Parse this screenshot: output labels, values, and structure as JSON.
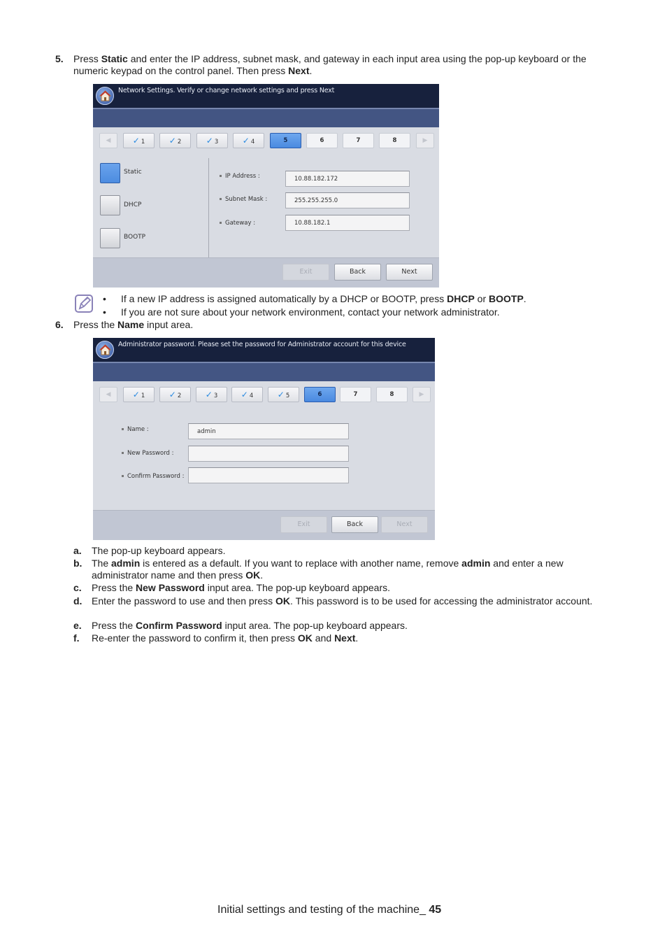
{
  "step5": {
    "number": "5.",
    "parts": [
      "Press ",
      "Static",
      " and enter the IP address, subnet mask, and gateway in each input area using the pop-up keyboard or the",
      "numeric keypad on the control panel. Then press ",
      "Next",
      "."
    ]
  },
  "screen1": {
    "title": "Network Settings. Verify or change network settings and press Next",
    "home_icon": "home-icon",
    "steps": [
      {
        "label": "1",
        "state": "done"
      },
      {
        "label": "2",
        "state": "done"
      },
      {
        "label": "3",
        "state": "done"
      },
      {
        "label": "4",
        "state": "done"
      },
      {
        "label": "5",
        "state": "active"
      },
      {
        "label": "6",
        "state": "todo"
      },
      {
        "label": "7",
        "state": "todo"
      },
      {
        "label": "8",
        "state": "todo"
      }
    ],
    "prev_arrow": "◀",
    "next_arrow": "▶",
    "options": [
      {
        "label": "Static",
        "selected": true
      },
      {
        "label": "DHCP",
        "selected": false
      },
      {
        "label": "BOOTP",
        "selected": false
      }
    ],
    "fields": [
      {
        "label": "IP Address :",
        "value": "10.88.182.172"
      },
      {
        "label": "Subnet Mask :",
        "value": "255.255.255.0"
      },
      {
        "label": "Gateway :",
        "value": "10.88.182.1"
      }
    ],
    "buttons": {
      "exit": "Exit",
      "back": "Back",
      "next": "Next"
    }
  },
  "note": {
    "icon": "note-pencil-icon",
    "bullets": [
      [
        "If a new IP address is assigned automatically by a DHCP or BOOTP, press ",
        "DHCP",
        " or ",
        "BOOTP",
        "."
      ],
      [
        "If you are not sure about your network environment, contact your network administrator."
      ]
    ]
  },
  "step6": {
    "number": "6.",
    "parts": [
      "Press the ",
      "Name",
      " input area."
    ]
  },
  "screen2": {
    "title": "Administrator password. Please set the password for Administrator account for this device",
    "home_icon": "home-icon",
    "steps": [
      {
        "label": "1",
        "state": "done"
      },
      {
        "label": "2",
        "state": "done"
      },
      {
        "label": "3",
        "state": "done"
      },
      {
        "label": "4",
        "state": "done"
      },
      {
        "label": "5",
        "state": "done"
      },
      {
        "label": "6",
        "state": "active"
      },
      {
        "label": "7",
        "state": "todo"
      },
      {
        "label": "8",
        "state": "todo"
      }
    ],
    "prev_arrow": "◀",
    "next_arrow": "▶",
    "fields": [
      {
        "label": "Name :",
        "value": "admin"
      },
      {
        "label": "New Password :",
        "value": ""
      },
      {
        "label": "Confirm Password :",
        "value": ""
      }
    ],
    "buttons": {
      "exit": "Exit",
      "back": "Back",
      "next": "Next"
    }
  },
  "substeps": [
    {
      "letter": "a.",
      "parts": [
        "The pop-up keyboard appears."
      ]
    },
    {
      "letter": "b.",
      "parts": [
        "The ",
        "admin",
        " is entered as a default. If you want to replace with another name, remove ",
        "admin",
        " and enter a new administrator name and then press ",
        "OK",
        "."
      ]
    },
    {
      "letter": "c.",
      "parts": [
        "Press the ",
        "New Password",
        " input area. The pop-up keyboard appears."
      ]
    },
    {
      "letter": "d.",
      "parts": [
        "Enter the password to use and then press ",
        "OK",
        ". This password is to be used for accessing the administrator account."
      ]
    },
    {
      "letter": "e.",
      "parts": [
        "Press the ",
        "Confirm Password",
        " input area. The pop-up keyboard appears."
      ]
    },
    {
      "letter": "f.",
      "parts": [
        "Re-enter the password to confirm it, then press ",
        "OK",
        " and ",
        "Next",
        "."
      ]
    }
  ],
  "footer": {
    "text": "Initial settings and testing of the machine_ ",
    "page": "45"
  }
}
